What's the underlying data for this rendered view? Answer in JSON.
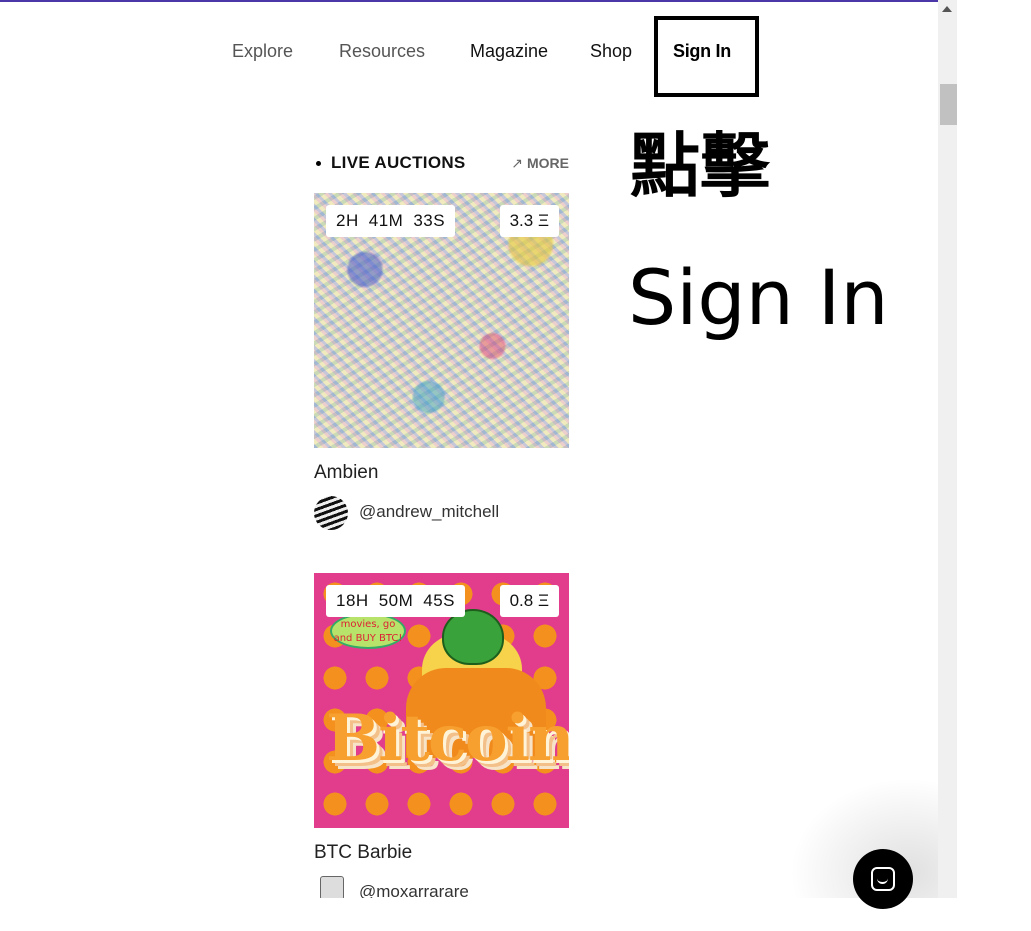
{
  "nav": {
    "explore": "Explore",
    "resources": "Resources",
    "magazine": "Magazine",
    "shop": "Shop",
    "sign_in": "Sign In"
  },
  "annotation": {
    "line1": "點擊",
    "line2": "Sign In"
  },
  "live_auctions": {
    "title": "LIVE AUCTIONS",
    "more_label": "MORE",
    "more_icon": "arrow-up-right-icon",
    "cards": [
      {
        "timer": {
          "hours": "2H",
          "minutes": "41M",
          "seconds": "33S"
        },
        "price": "3.3 Ξ",
        "title": "Ambien",
        "username": "@andrew_mitchell"
      },
      {
        "timer": {
          "hours": "18H",
          "minutes": "50M",
          "seconds": "45S"
        },
        "price": "0.8 Ξ",
        "title": "BTC Barbie",
        "username": "@moxarrarare",
        "artwork_text": "Bitcoin",
        "speech_bubble": "movies, go and BUY BTC!"
      }
    ]
  },
  "colors": {
    "top_accent": "#4c37a8",
    "chat_button": "#000000"
  },
  "chat_widget": {
    "icon": "chat-icon"
  }
}
